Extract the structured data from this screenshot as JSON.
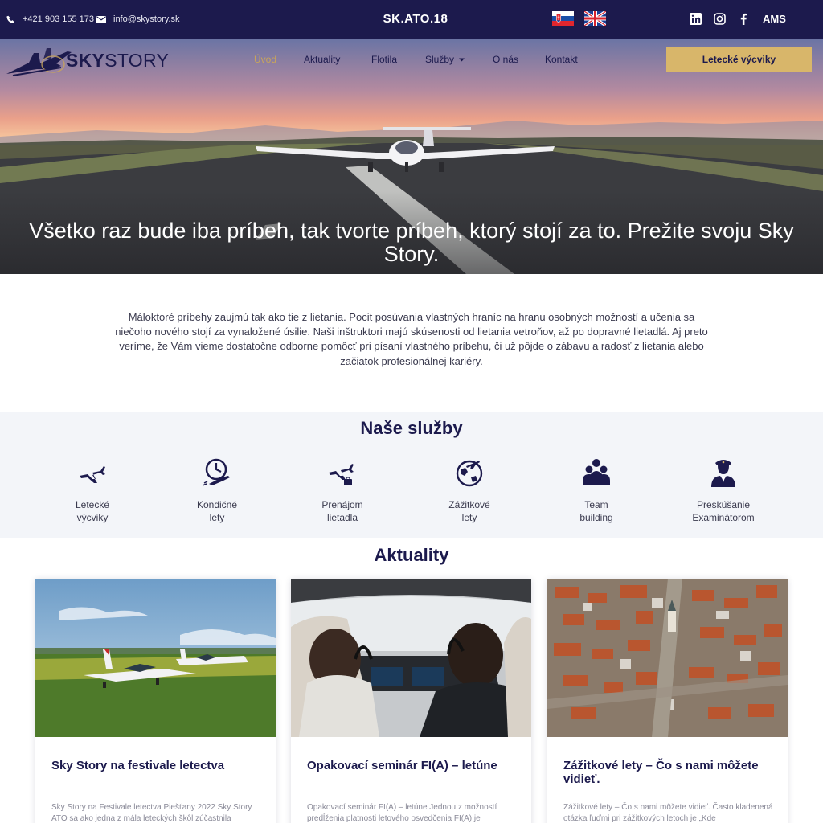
{
  "topbar": {
    "phone": "+421 903 155 173",
    "email": "info@skystory.sk",
    "brand_code": "SK.ATO.18",
    "flags": [
      "slovak-flag",
      "uk-flag"
    ],
    "social": [
      "linkedin-icon",
      "instagram-icon",
      "facebook-icon"
    ],
    "ams_label": "AMS",
    "colors": {
      "background": "#1c1a4d",
      "text": "#ffffff"
    }
  },
  "logo": {
    "bold": "SKY",
    "light": "STORY"
  },
  "nav": {
    "items": [
      "Úvod",
      "Aktuality",
      "Flotila",
      "Služby",
      "O nás",
      "Kontakt"
    ],
    "active_item": "Úvod",
    "cta_label": "Letecké výcviky",
    "colors": {
      "active": "#c9a55a",
      "cta_bg": "#d8b66a"
    }
  },
  "hero": {
    "headline": "Všetko raz bude iba príbeh, tak tvorte príbeh, ktorý stojí za to. Prežite svoju Sky Story."
  },
  "intro": {
    "text": "Máloktoré príbehy zaujmú tak ako tie z lietania. Pocit posúvania vlastných hraníc na hranu osobných možností a učenia sa niečoho nového stojí za vynaložené úsilie. Naši inštruktori majú skúsenosti od lietania vetroňov, až po dopravné lietadlá. Aj preto veríme, že Vám vieme dostatočne odborne pomôcť pri písaní vlastného príbehu, či už pôjde o zábavu a radosť z lietania alebo začiatok profesionálnej kariéry."
  },
  "services": {
    "title": "Naše služby",
    "items": [
      {
        "line1": "Letecké",
        "line2": "výcviky",
        "icon": "airplane-icon"
      },
      {
        "line1": "Kondičné",
        "line2": "lety",
        "icon": "clock-plane-icon"
      },
      {
        "line1": "Prenájom",
        "line2": "lietadla",
        "icon": "plane-rental-icon"
      },
      {
        "line1": "Zážitkové",
        "line2": "lety",
        "icon": "globe-plane-icon"
      },
      {
        "line1": "Team",
        "line2": "building",
        "icon": "team-icon"
      },
      {
        "line1": "Preskúšanie",
        "line2": "Examinátorom",
        "icon": "pilot-examiner-icon"
      }
    ]
  },
  "news": {
    "title": "Aktuality",
    "cards": [
      {
        "title": "Sky Story na festivale letectva",
        "excerpt": "Sky Story na Festivale letectva Piešťany 2022 Sky Story ATO sa ako jedna z mála leteckých škôl zúčastnila",
        "image": "airplanes-on-grass-image"
      },
      {
        "title": "Opakovací seminár FI(A) – letúne",
        "excerpt": "Opakovací seminár FI(A) – letúne Jednou z možností predĺženia platnosti letového osvedčenia FI(A) je",
        "image": "cockpit-pilots-image"
      },
      {
        "title": "Zážitkové lety – Čo s nami môžete vidieť.",
        "excerpt": "Zážitkové lety – Čo s nami môžete vidieť. Často kladenená otázka ľuďmi pri zážitkových letoch je „Kde",
        "image": "aerial-town-image"
      }
    ]
  }
}
